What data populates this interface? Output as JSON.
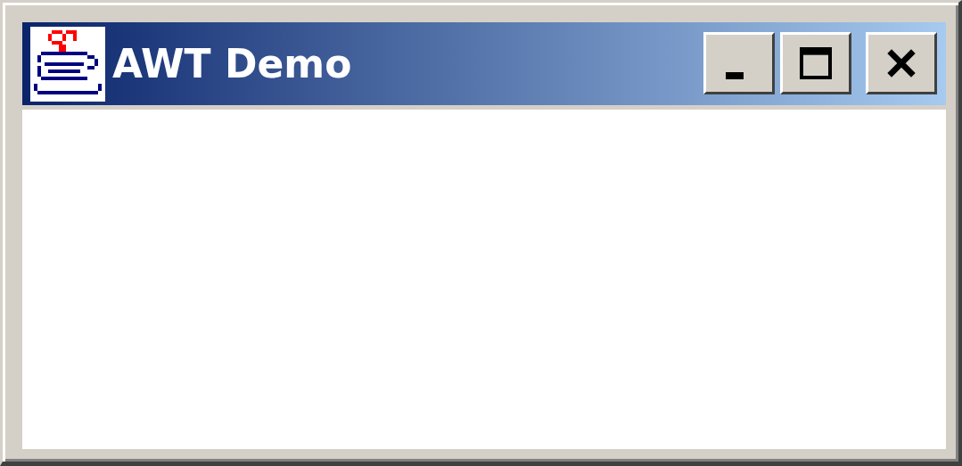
{
  "window": {
    "title": "AWT Demo"
  }
}
